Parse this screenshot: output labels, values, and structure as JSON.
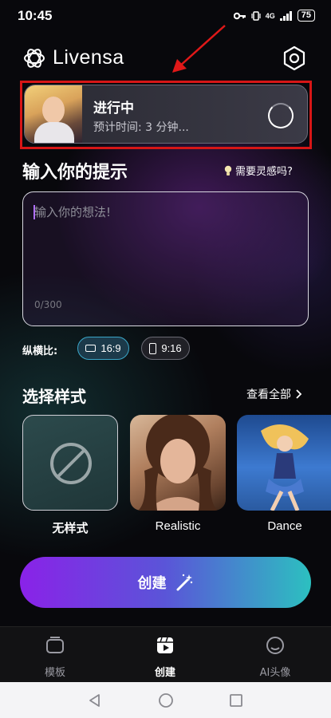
{
  "status_bar": {
    "time": "10:45",
    "network": "4G",
    "battery": "75"
  },
  "header": {
    "app_name": "Livensa"
  },
  "progress": {
    "title": "进行中",
    "subtitle": "预计时间: 3 分钟..."
  },
  "prompt": {
    "title": "输入你的提示",
    "inspiration_link": "需要灵感吗?",
    "placeholder": "输入你的想法!",
    "value": "",
    "counter": "0/300"
  },
  "aspect": {
    "label": "纵横比:",
    "options": [
      {
        "label": "16:9",
        "selected": true
      },
      {
        "label": "9:16",
        "selected": false
      }
    ]
  },
  "styles": {
    "title": "选择样式",
    "view_all": "查看全部",
    "items": [
      {
        "name": "无样式",
        "icon": "no-style-icon"
      },
      {
        "name": "Realistic"
      },
      {
        "name": "Dance"
      }
    ]
  },
  "create_button": {
    "label": "创建"
  },
  "bottom_nav": [
    {
      "label": "模板",
      "icon": "template-icon",
      "active": false
    },
    {
      "label": "创建",
      "icon": "create-video-icon",
      "active": true
    },
    {
      "label": "AI头像",
      "icon": "avatar-icon",
      "active": false
    }
  ],
  "colors": {
    "highlight": "#d71616",
    "accent_start": "#8a22e8",
    "accent_end": "#2cc0c0",
    "chip_selected": "#3aa6c8"
  }
}
